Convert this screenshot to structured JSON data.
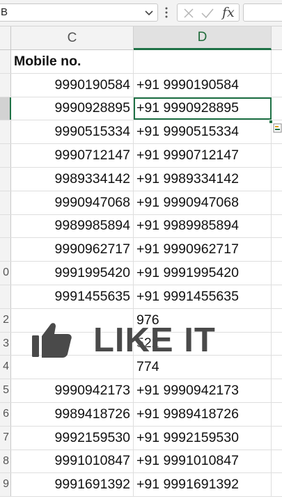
{
  "formula_bar": {
    "name_box_value": "B",
    "formula_value": "",
    "fx_label": "fx"
  },
  "columns": [
    {
      "label": "C"
    },
    {
      "label": "D"
    }
  ],
  "rows": [
    {
      "num": "",
      "c": "Mobile no.",
      "d": ""
    },
    {
      "num": "",
      "c": "9990190584",
      "d": "+91 9990190584"
    },
    {
      "num": "",
      "c": "9990928895",
      "d": "+91 9990928895"
    },
    {
      "num": "",
      "c": "9990515334",
      "d": "+91 9990515334"
    },
    {
      "num": "",
      "c": "9990712147",
      "d": "+91 9990712147"
    },
    {
      "num": "",
      "c": "9989334142",
      "d": "+91 9989334142"
    },
    {
      "num": "",
      "c": "9990947068",
      "d": "+91 9990947068"
    },
    {
      "num": "",
      "c": "9989985894",
      "d": "+91 9989985894"
    },
    {
      "num": "",
      "c": "9990962717",
      "d": "+91 9990962717"
    },
    {
      "num": "0",
      "c": "9991995420",
      "d": "+91 9991995420"
    },
    {
      "num": "",
      "c": "9991455635",
      "d": "+91 9991455635"
    },
    {
      "num": "2",
      "c": "",
      "d": "976"
    },
    {
      "num": "3",
      "c": "",
      "d": "522"
    },
    {
      "num": "4",
      "c": "",
      "d": "774"
    },
    {
      "num": "5",
      "c": "9990942173",
      "d": "+91 9990942173"
    },
    {
      "num": "6",
      "c": "9989418726",
      "d": "+91 9989418726"
    },
    {
      "num": "7",
      "c": "9992159530",
      "d": "+91 9992159530"
    },
    {
      "num": "8",
      "c": "9991010847",
      "d": "+91 9991010847"
    },
    {
      "num": "9",
      "c": "9991691392",
      "d": "+91 9991691392"
    }
  ],
  "overlay": {
    "text": "LIKE IT",
    "icon": "thumbs-up-icon"
  },
  "colors": {
    "accent": "#1e7145",
    "header_bg": "#f3f3f3",
    "overlay_text": "#4a4a4a"
  }
}
